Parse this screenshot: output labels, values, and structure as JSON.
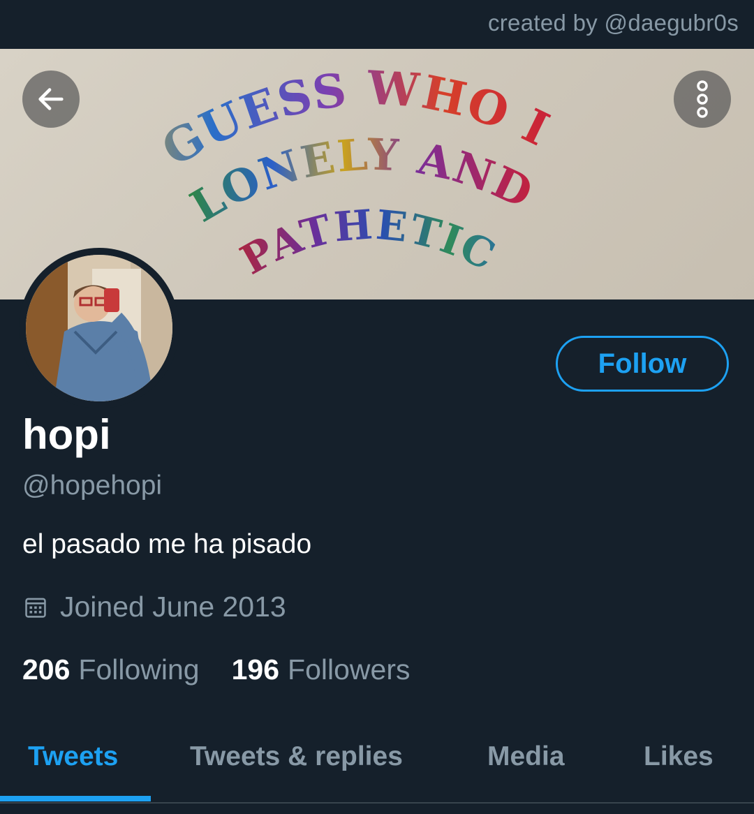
{
  "credit": "created by @daegubr0s",
  "banner": {
    "lines": [
      "GUESS WHO IS",
      "LONELY AND",
      "PATHETIC"
    ]
  },
  "header": {
    "back_icon": "arrow-left-icon",
    "more_icon": "vertical-dots-icon"
  },
  "profile": {
    "display_name": "hopi",
    "handle": "@hopehopi",
    "bio": "el pasado me ha pisado",
    "joined": "Joined June 2013",
    "joined_icon": "calendar-icon",
    "follow_label": "Follow",
    "following_count": "206",
    "following_label": "Following",
    "followers_count": "196",
    "followers_label": "Followers"
  },
  "tabs": [
    {
      "label": "Tweets",
      "active": true
    },
    {
      "label": "Tweets & replies",
      "active": false
    },
    {
      "label": "Media",
      "active": false
    },
    {
      "label": "Likes",
      "active": false
    }
  ],
  "colors": {
    "background": "#15202b",
    "accent": "#1da1f2",
    "muted_text": "#8899a6"
  }
}
